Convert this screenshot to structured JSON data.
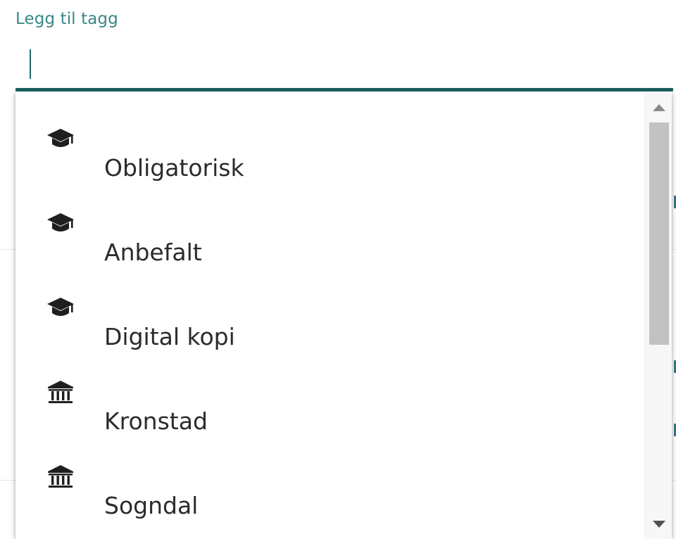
{
  "field": {
    "label": "Legg til tagg",
    "value": ""
  },
  "options": [
    {
      "icon": "graduation-cap-icon",
      "label": "Obligatorisk"
    },
    {
      "icon": "graduation-cap-icon",
      "label": "Anbefalt"
    },
    {
      "icon": "graduation-cap-icon",
      "label": "Digital kopi"
    },
    {
      "icon": "institution-icon",
      "label": "Kronstad"
    },
    {
      "icon": "institution-icon",
      "label": "Sogndal"
    }
  ],
  "colors": {
    "accent": "#1c6363",
    "label": "#3a8686",
    "icon": "#1f1f1f",
    "scroll_thumb": "#c2c2c2"
  }
}
